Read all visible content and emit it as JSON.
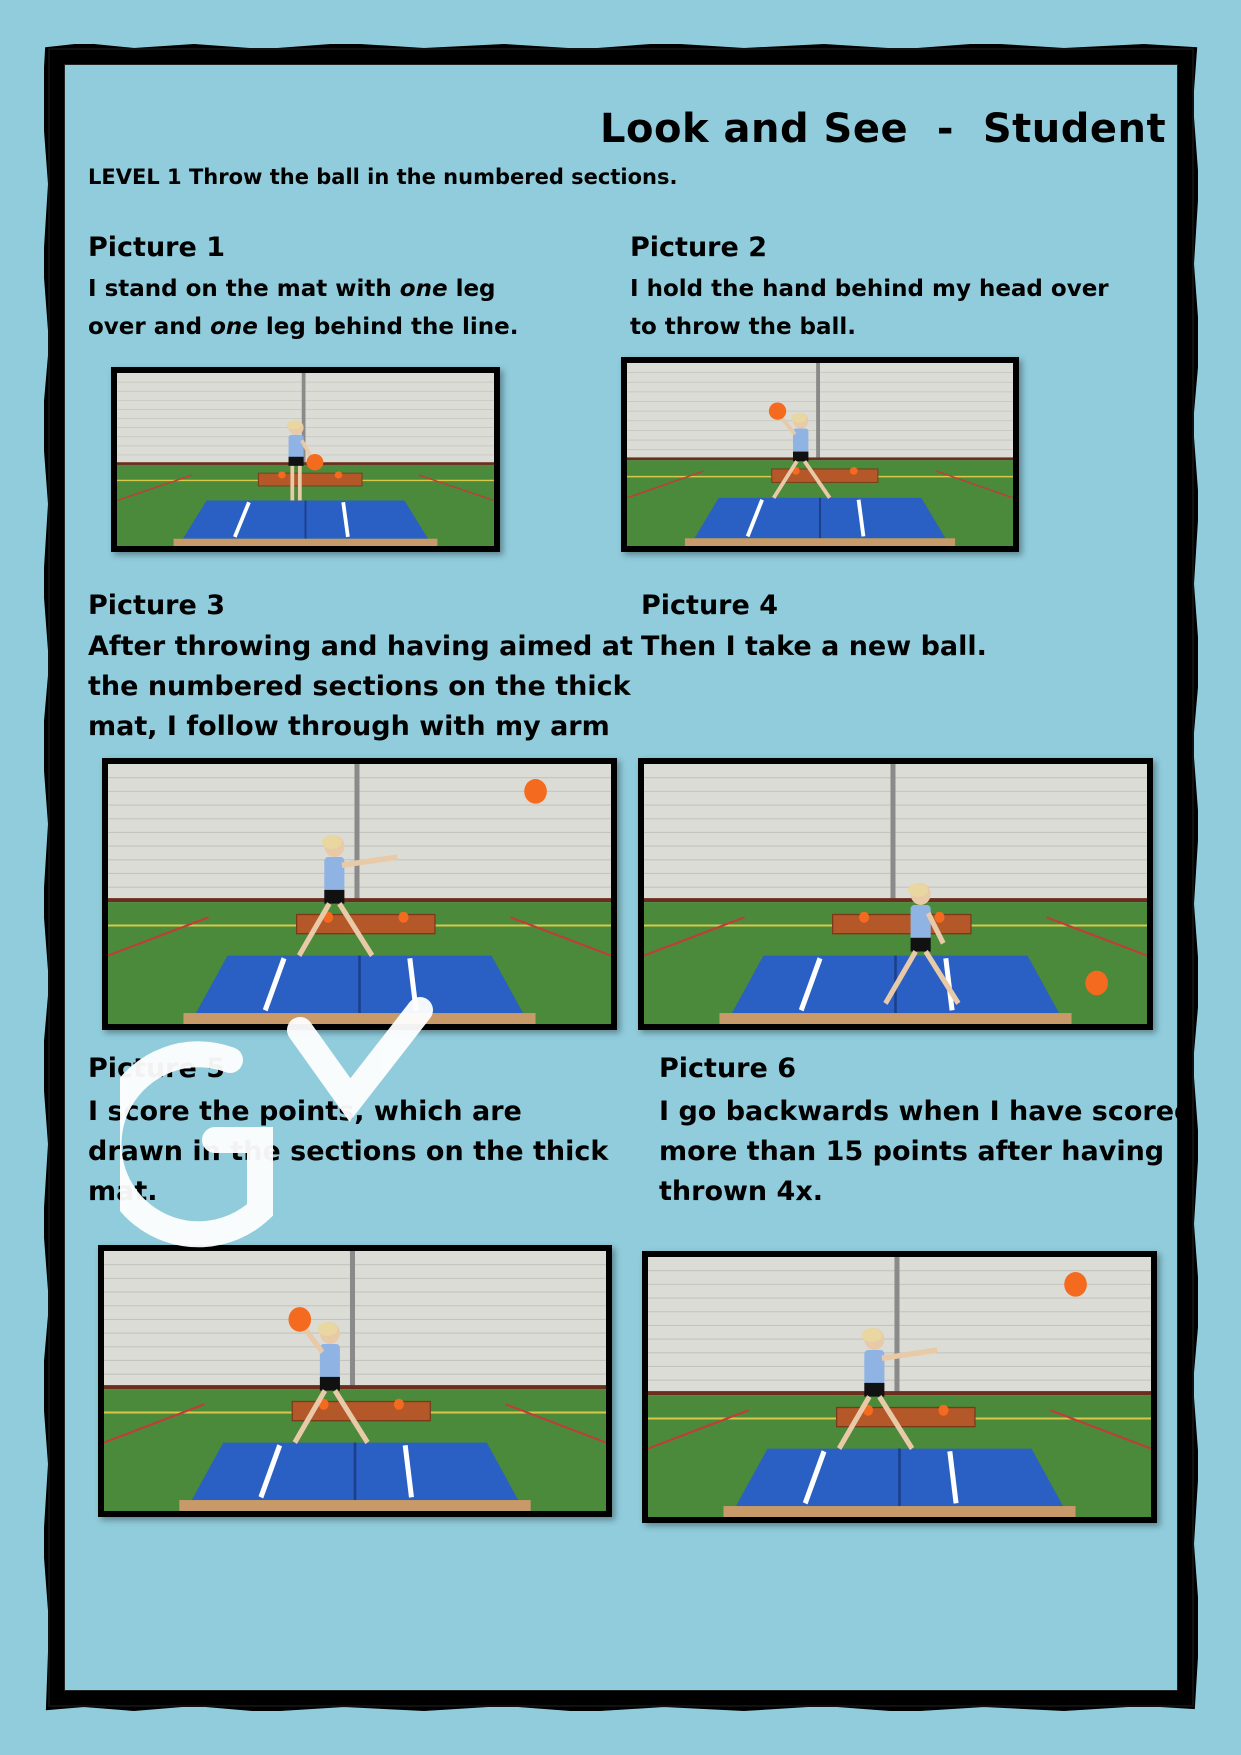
{
  "document": {
    "title": "Look and See  -  Student",
    "level_instruction": "LEVEL 1 Throw the ball in the numbered sections."
  },
  "pictures": [
    {
      "heading": "Picture 1",
      "lines": [
        "I stand on the mat with one leg",
        "over and one leg behind the line."
      ]
    },
    {
      "heading": "Picture 2",
      "lines": [
        "I hold the hand behind my head over",
        "to throw the ball."
      ]
    },
    {
      "heading": "Picture 3",
      "lines": [
        "After throwing and having aimed at",
        "the numbered sections on the thick",
        "mat, I follow through with my arm"
      ]
    },
    {
      "heading": "Picture 4",
      "lines": [
        "Then I take a new ball."
      ]
    },
    {
      "heading": "Picture 5",
      "lines": [
        "I score the points, which are",
        "drawn in the sections on the thick",
        "mat."
      ]
    },
    {
      "heading": "Picture 6",
      "lines": [
        "I go backwards when I have scored",
        "more than 15 points after having",
        "thrown 4x."
      ]
    }
  ],
  "colors": {
    "background": "#90ccdc",
    "border": "#000000",
    "wall": "#dcdcd6",
    "floor": "#4a8a3a",
    "mat": "#2a5fc4",
    "ball": "#f46a1e"
  }
}
